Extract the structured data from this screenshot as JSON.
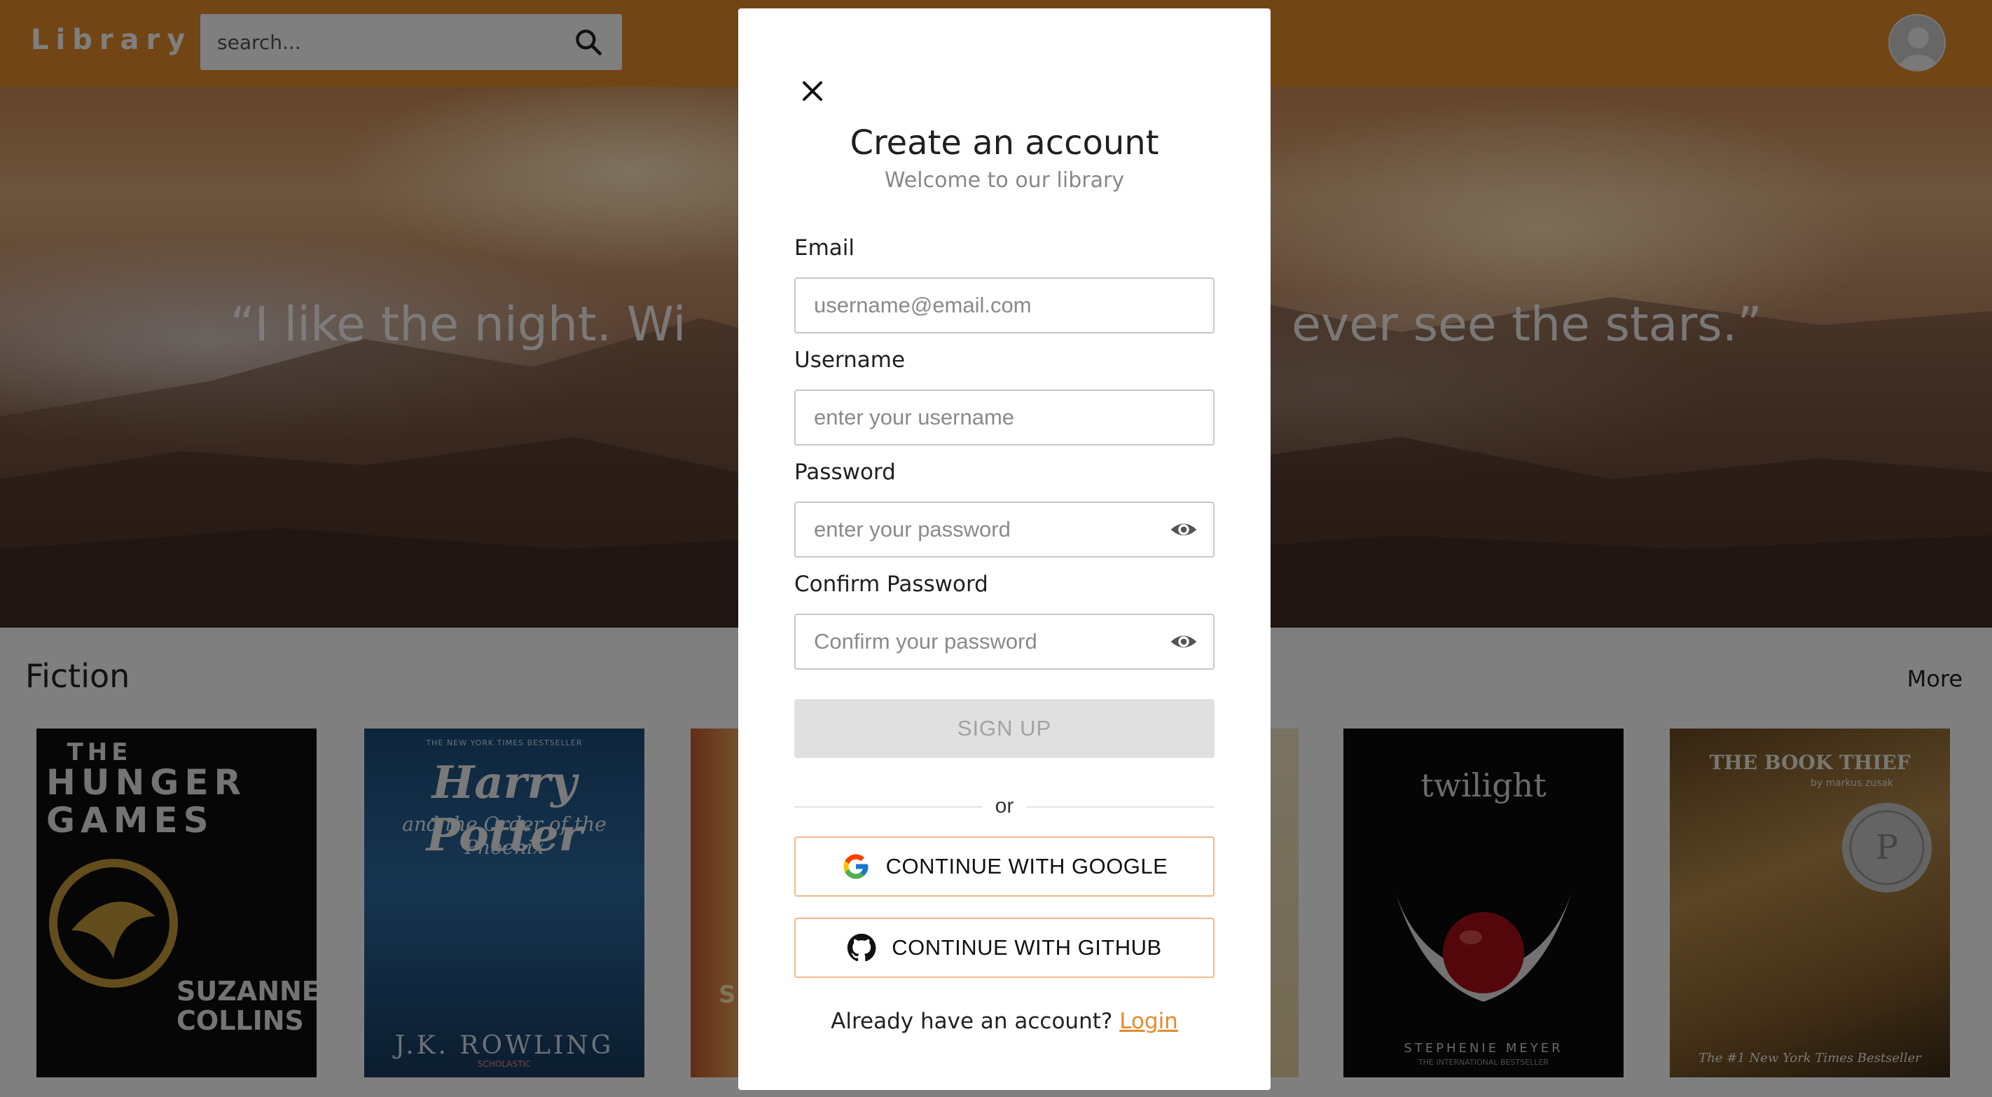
{
  "header": {
    "logo": "Library",
    "search_placeholder": "search...",
    "search_icon": "search-icon",
    "avatar_icon": "user-avatar-icon"
  },
  "hero": {
    "quote": "“I like the night. Wi                                        ever see the stars.”"
  },
  "section": {
    "title": "Fiction",
    "more": "More"
  },
  "books": [
    {
      "top": "THE",
      "title": "HUNGER GAMES",
      "author": "SUZANNE COLLINS"
    },
    {
      "top": "THE NEW YORK TIMES BESTSELLER",
      "title": "Harry Potter",
      "subtitle": "and the Order of the Phoenix",
      "author": "J.K. ROWLING",
      "publisher": "SCHOLASTIC"
    },
    {
      "title": "S"
    },
    {
      "title": ""
    },
    {
      "title": "twilight",
      "author": "STEPHENIE MEYER",
      "tagline": "THE INTERNATIONAL BESTSELLER"
    },
    {
      "title": "THE BOOK THIEF",
      "author": "by markus zusak",
      "tagline": "The #1 New York Times Bestseller"
    }
  ],
  "modal": {
    "close_icon": "close-icon",
    "title": "Create an account",
    "subtitle": "Welcome to our library",
    "email_label": "Email",
    "email_placeholder": "username@email.com",
    "username_label": "Username",
    "username_placeholder": "enter your username",
    "password_label": "Password",
    "password_placeholder": "enter your password",
    "confirm_label": "Confirm Password",
    "confirm_placeholder": "Confirm your password",
    "eye_icon": "eye-icon",
    "signup": "SIGN UP",
    "or": "or",
    "google": "CONTINUE WITH GOOGLE",
    "github": "CONTINUE WITH GITHUB",
    "footer_prompt": "Already have an account?",
    "footer_link": "Login"
  },
  "colors": {
    "brand": "#e48a2a",
    "oauth_border": "#f2b98a",
    "disabled_bg": "#e0e0e0"
  }
}
